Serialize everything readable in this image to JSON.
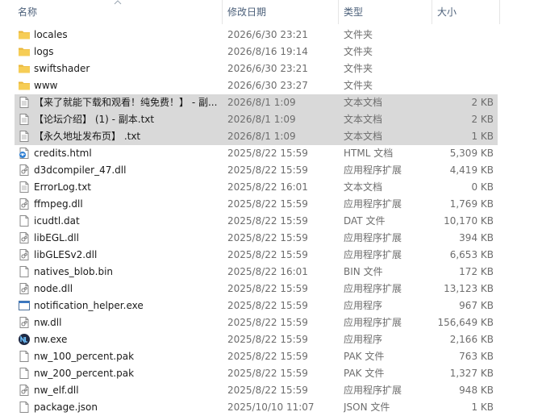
{
  "columns": {
    "name": "名称",
    "date": "修改日期",
    "type": "类型",
    "size": "大小"
  },
  "files": [
    {
      "name": "locales",
      "date": "2026/6/30 23:21",
      "type": "文件夹",
      "size": "",
      "icon": "folder-icon",
      "selected": false
    },
    {
      "name": "logs",
      "date": "2026/8/16 19:14",
      "type": "文件夹",
      "size": "",
      "icon": "folder-icon",
      "selected": false
    },
    {
      "name": "swiftshader",
      "date": "2026/6/30 23:21",
      "type": "文件夹",
      "size": "",
      "icon": "folder-icon",
      "selected": false
    },
    {
      "name": "www",
      "date": "2026/6/30 23:27",
      "type": "文件夹",
      "size": "",
      "icon": "folder-icon",
      "selected": false
    },
    {
      "name": "【来了就能下载和观看！纯免费！】 - 副...",
      "date": "2026/8/1 1:09",
      "type": "文本文档",
      "size": "2 KB",
      "icon": "text-file-icon",
      "selected": true
    },
    {
      "name": "【论坛介绍】 (1) - 副本.txt",
      "date": "2026/8/1 1:09",
      "type": "文本文档",
      "size": "2 KB",
      "icon": "text-file-icon",
      "selected": true
    },
    {
      "name": "【永久地址发布页】 .txt",
      "date": "2026/8/1 1:09",
      "type": "文本文档",
      "size": "1 KB",
      "icon": "text-file-icon",
      "selected": true
    },
    {
      "name": "credits.html",
      "date": "2025/8/22 15:59",
      "type": "HTML 文档",
      "size": "5,309 KB",
      "icon": "html-file-icon",
      "selected": false
    },
    {
      "name": "d3dcompiler_47.dll",
      "date": "2025/8/22 15:59",
      "type": "应用程序扩展",
      "size": "4,419 KB",
      "icon": "dll-file-icon",
      "selected": false
    },
    {
      "name": "ErrorLog.txt",
      "date": "2025/8/22 16:01",
      "type": "文本文档",
      "size": "0 KB",
      "icon": "text-file-icon",
      "selected": false
    },
    {
      "name": "ffmpeg.dll",
      "date": "2025/8/22 15:59",
      "type": "应用程序扩展",
      "size": "1,769 KB",
      "icon": "dll-file-icon",
      "selected": false
    },
    {
      "name": "icudtl.dat",
      "date": "2025/8/22 15:59",
      "type": "DAT 文件",
      "size": "10,170 KB",
      "icon": "blank-file-icon",
      "selected": false
    },
    {
      "name": "libEGL.dll",
      "date": "2025/8/22 15:59",
      "type": "应用程序扩展",
      "size": "394 KB",
      "icon": "dll-file-icon",
      "selected": false
    },
    {
      "name": "libGLESv2.dll",
      "date": "2025/8/22 15:59",
      "type": "应用程序扩展",
      "size": "6,653 KB",
      "icon": "dll-file-icon",
      "selected": false
    },
    {
      "name": "natives_blob.bin",
      "date": "2025/8/22 16:01",
      "type": "BIN 文件",
      "size": "172 KB",
      "icon": "blank-file-icon",
      "selected": false
    },
    {
      "name": "node.dll",
      "date": "2025/8/22 15:59",
      "type": "应用程序扩展",
      "size": "13,123 KB",
      "icon": "dll-file-icon",
      "selected": false
    },
    {
      "name": "notification_helper.exe",
      "date": "2025/8/22 15:59",
      "type": "应用程序",
      "size": "967 KB",
      "icon": "exe-window-icon",
      "selected": false
    },
    {
      "name": "nw.dll",
      "date": "2025/8/22 15:59",
      "type": "应用程序扩展",
      "size": "156,649 KB",
      "icon": "dll-file-icon",
      "selected": false
    },
    {
      "name": "nw.exe",
      "date": "2025/8/22 15:59",
      "type": "应用程序",
      "size": "2,166 KB",
      "icon": "nwjs-app-icon",
      "selected": false
    },
    {
      "name": "nw_100_percent.pak",
      "date": "2025/8/22 15:59",
      "type": "PAK 文件",
      "size": "763 KB",
      "icon": "blank-file-icon",
      "selected": false
    },
    {
      "name": "nw_200_percent.pak",
      "date": "2025/8/22 15:59",
      "type": "PAK 文件",
      "size": "1,327 KB",
      "icon": "blank-file-icon",
      "selected": false
    },
    {
      "name": "nw_elf.dll",
      "date": "2025/8/22 15:59",
      "type": "应用程序扩展",
      "size": "948 KB",
      "icon": "dll-file-icon",
      "selected": false
    },
    {
      "name": "package.json",
      "date": "2025/10/10 11:07",
      "type": "JSON 文件",
      "size": "1 KB",
      "icon": "blank-file-icon",
      "selected": false
    }
  ],
  "colors": {
    "selection": "#d9d9d9",
    "header_text": "#4c607a",
    "secondary_text": "#6d6d6d",
    "folder": "#f4c542"
  }
}
